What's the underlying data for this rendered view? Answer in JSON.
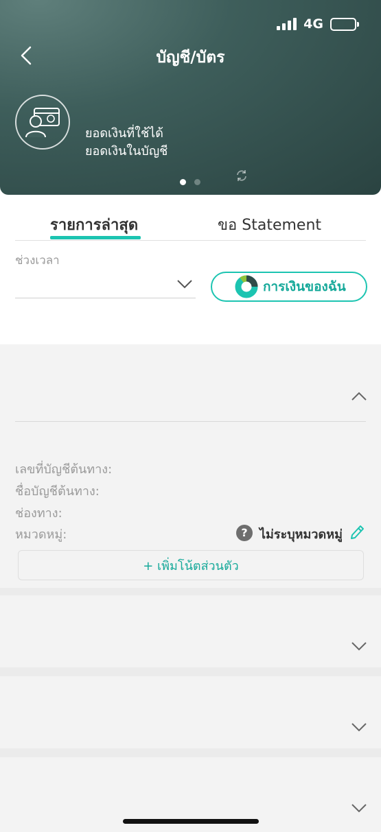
{
  "status_bar": {
    "network": "4G"
  },
  "header": {
    "title": "บัญชี/บัตร",
    "available_balance_label": "ยอดเงินที่ใช้ได้",
    "account_balance_label": "ยอดเงินในบัญชี",
    "carousel": {
      "total": 2,
      "active": 1
    }
  },
  "tabs": [
    {
      "label": "รายการล่าสุด",
      "active": true
    },
    {
      "label": "ขอ Statement",
      "active": false
    }
  ],
  "filter": {
    "period_label": "ช่วงเวลา",
    "period_value": "",
    "my_money_button": "การเงินของฉัน"
  },
  "transaction_expanded": {
    "source_account_number_label": "เลขที่บัญชีต้นทาง:",
    "source_account_name_label": "ชื่อบัญชีต้นทาง:",
    "channel_label": "ช่องทาง:",
    "category_label": "หมวดหมู่:",
    "category_value": "ไม่ระบุหมวดหมู่",
    "add_note": "+ เพิ่มโน้ตส่วนตัว"
  },
  "colors": {
    "accent": "#1cc4b1",
    "header_dark": "#2a4341",
    "header_light": "#5f7f7b",
    "card_bg": "#f3f3f3"
  }
}
